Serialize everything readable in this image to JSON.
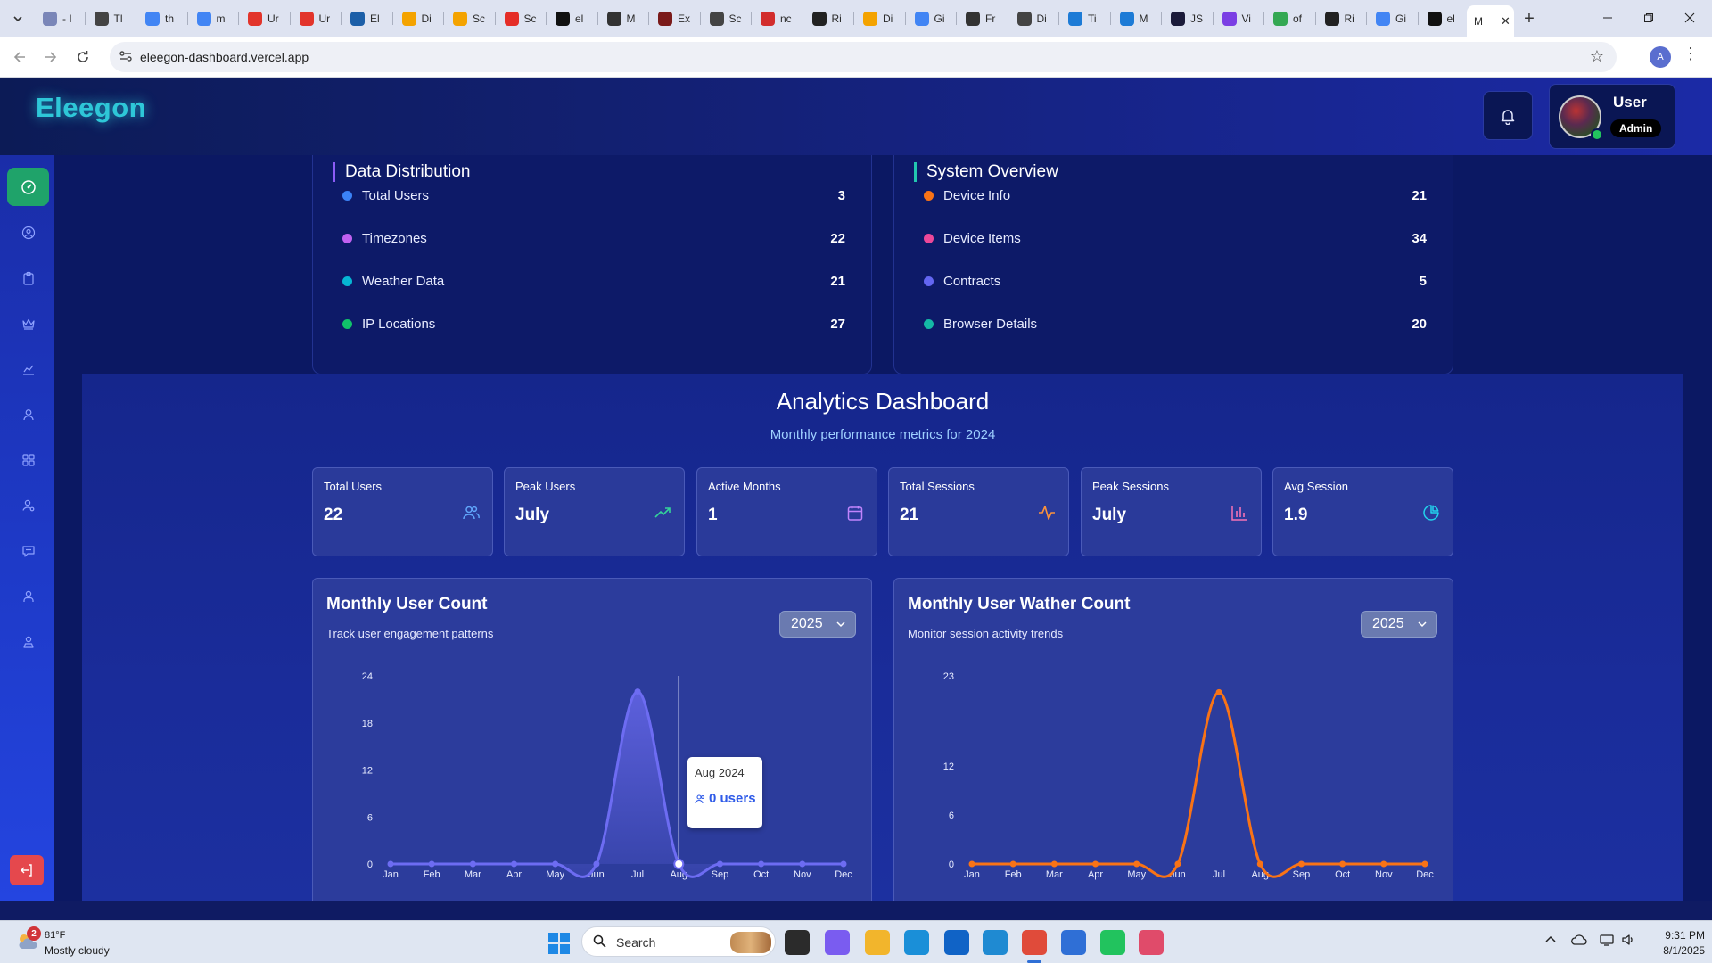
{
  "browser": {
    "tabs": [
      {
        "label": "- I",
        "color": "#7a86b8"
      },
      {
        "label": "Tl",
        "color": "#444444"
      },
      {
        "label": "th",
        "color": "#4285f4"
      },
      {
        "label": "m",
        "color": "#4285f4"
      },
      {
        "label": "Ur",
        "color": "#e2342b"
      },
      {
        "label": "Ur",
        "color": "#e2342b"
      },
      {
        "label": "El",
        "color": "#1c5fa8"
      },
      {
        "label": "Di",
        "color": "#f4a300"
      },
      {
        "label": "Sc",
        "color": "#f4a300"
      },
      {
        "label": "Sc",
        "color": "#e52d27"
      },
      {
        "label": "el",
        "color": "#111111"
      },
      {
        "label": "M",
        "color": "#333333"
      },
      {
        "label": "Ex",
        "color": "#7a1a1a"
      },
      {
        "label": "Sc",
        "color": "#444444"
      },
      {
        "label": "nc",
        "color": "#d22d2d"
      },
      {
        "label": "Ri",
        "color": "#222222"
      },
      {
        "label": "Di",
        "color": "#f4a300"
      },
      {
        "label": "Gi",
        "color": "#4285f4"
      },
      {
        "label": "Fr",
        "color": "#333333"
      },
      {
        "label": "Di",
        "color": "#444444"
      },
      {
        "label": "Ti",
        "color": "#1d7bd6"
      },
      {
        "label": "M",
        "color": "#1d7bd6"
      },
      {
        "label": "JS",
        "color": "#1b1b3a"
      },
      {
        "label": "Vi",
        "color": "#7b3fe4"
      },
      {
        "label": "of",
        "color": "#34a853"
      },
      {
        "label": "Ri",
        "color": "#222222"
      },
      {
        "label": "Gi",
        "color": "#4285f4"
      },
      {
        "label": "el",
        "color": "#111111"
      },
      {
        "label": "M",
        "color": "#222222"
      }
    ],
    "url": "eleegon-dashboard.vercel.app",
    "profile_initial": "A"
  },
  "app": {
    "logo": "Eleegon",
    "user": {
      "name": "User",
      "role": "Admin"
    },
    "sidebar_icons": [
      "dashboard-icon",
      "user-circle-icon",
      "clipboard-icon",
      "crown-icon",
      "chart-icon",
      "user-icon",
      "grid-icon",
      "user-search-icon",
      "message-icon",
      "person-icon",
      "user-group-icon"
    ],
    "data_distribution": {
      "title": "Data Distribution",
      "rows": [
        {
          "label": "Total Users",
          "value": "3",
          "color": "#3b82f6"
        },
        {
          "label": "Timezones",
          "value": "22",
          "color": "#c061f0"
        },
        {
          "label": "Weather Data",
          "value": "21",
          "color": "#06b6d4"
        },
        {
          "label": "IP Locations",
          "value": "27",
          "color": "#10c26a"
        }
      ]
    },
    "system_overview": {
      "title": "System Overview",
      "rows": [
        {
          "label": "Device Info",
          "value": "21",
          "color": "#f97316"
        },
        {
          "label": "Device Items",
          "value": "34",
          "color": "#ec4899"
        },
        {
          "label": "Contracts",
          "value": "5",
          "color": "#6366f1"
        },
        {
          "label": "Browser Details",
          "value": "20",
          "color": "#14b8a6"
        }
      ]
    },
    "analytics": {
      "title": "Analytics Dashboard",
      "subtitle": "Monthly performance metrics for 2024",
      "kpis": [
        {
          "label": "Total Users",
          "value": "22",
          "icon": "users-icon",
          "icon_color": "#60a5fa"
        },
        {
          "label": "Peak Users",
          "value": "July",
          "icon": "trend-up-icon",
          "icon_color": "#34d399"
        },
        {
          "label": "Active Months",
          "value": "1",
          "icon": "calendar-icon",
          "icon_color": "#c084fc"
        },
        {
          "label": "Total Sessions",
          "value": "21",
          "icon": "activity-icon",
          "icon_color": "#fb923c"
        },
        {
          "label": "Peak Sessions",
          "value": "July",
          "icon": "bar-chart-icon",
          "icon_color": "#f472b6"
        },
        {
          "label": "Avg Session",
          "value": "1.9",
          "icon": "pie-chart-icon",
          "icon_color": "#22d3ee"
        }
      ]
    },
    "charts": {
      "user_count": {
        "title": "Monthly User Count",
        "subtitle": "Track user engagement patterns",
        "year": "2025"
      },
      "weather_count": {
        "title": "Monthly User Wather Count",
        "subtitle": "Monitor session activity trends",
        "year": "2025"
      }
    },
    "tooltip": {
      "title": "Aug 2024",
      "value": "0 users"
    }
  },
  "chart_data": [
    {
      "type": "area",
      "title": "Monthly User Count",
      "categories": [
        "Jan",
        "Feb",
        "Mar",
        "Apr",
        "May",
        "Jun",
        "Jul",
        "Aug",
        "Sep",
        "Oct",
        "Nov",
        "Dec"
      ],
      "series": [
        {
          "values": [
            0,
            0,
            0,
            0,
            0,
            0,
            22,
            0,
            0,
            0,
            0,
            0
          ]
        }
      ],
      "yticks": [
        0,
        6,
        12,
        18,
        24
      ],
      "ylim": [
        0,
        24
      ],
      "color": "#6d6cf2",
      "highlight_category": "Aug"
    },
    {
      "type": "line",
      "title": "Monthly User Wather Count",
      "categories": [
        "Jan",
        "Feb",
        "Mar",
        "Apr",
        "May",
        "Jun",
        "Jul",
        "Aug",
        "Sep",
        "Oct",
        "Nov",
        "Dec"
      ],
      "series": [
        {
          "values": [
            0,
            0,
            0,
            0,
            0,
            0,
            21,
            0,
            0,
            0,
            0,
            0
          ]
        }
      ],
      "yticks": [
        0,
        6,
        12,
        23
      ],
      "ylim": [
        0,
        23
      ],
      "color": "#f97316"
    }
  ],
  "taskbar": {
    "weather": {
      "temp": "81°F",
      "desc": "Mostly cloudy",
      "badge": "2"
    },
    "search_placeholder": "Search",
    "apps": [
      {
        "name": "task-view-app",
        "color": "#2b2b2b"
      },
      {
        "name": "copilot-app",
        "color": "#7a5cf0"
      },
      {
        "name": "file-explorer-app",
        "color": "#f2b52c"
      },
      {
        "name": "edge-app",
        "color": "#1a8fd8"
      },
      {
        "name": "outlook-app",
        "color": "#1063c6"
      },
      {
        "name": "vscode-app",
        "color": "#1f8ad2"
      },
      {
        "name": "chrome-app",
        "color": "#e04b3a"
      },
      {
        "name": "notepad-app",
        "color": "#2f6fd6"
      },
      {
        "name": "whatsapp-app",
        "color": "#22c35e"
      },
      {
        "name": "snipping-tool-app",
        "color": "#e04b6a"
      }
    ],
    "time": "9:31 PM",
    "date": "8/1/2025"
  }
}
